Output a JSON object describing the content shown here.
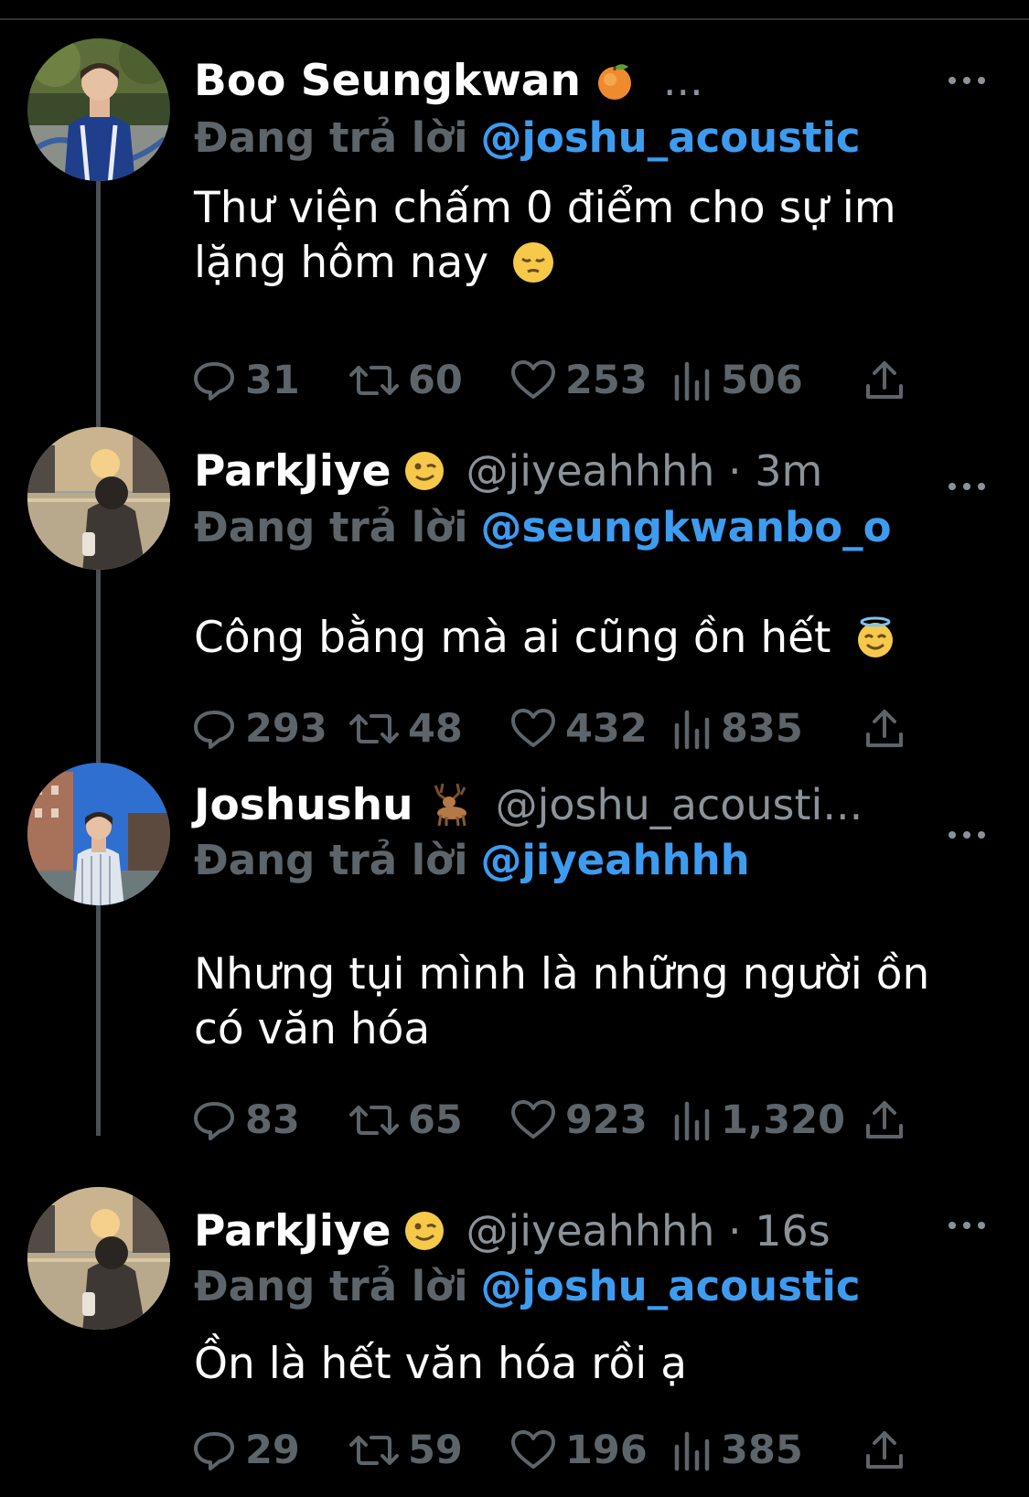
{
  "reply_prefix": "Đang trả lời",
  "tweets": [
    {
      "name": "Boo Seungkwan",
      "handle": "...",
      "badge_icon": "peach-icon",
      "mention": "@joshu_acoustic",
      "text": "Thư viện chấm 0 điểm cho sự im lặng hôm nay",
      "text_emoji": "pensive-face-icon",
      "replies": "31",
      "retweets": "60",
      "likes": "253",
      "views": "506"
    },
    {
      "name": "ParkJiye",
      "handle": "@jiyeahhhh · 3m",
      "badge_icon": "winking-face-icon",
      "mention": "@seungkwanbo_o",
      "text": "Công bằng mà ai cũng ồn hết",
      "text_emoji": "smiling-face-with-halo-icon",
      "replies": "293",
      "retweets": "48",
      "likes": "432",
      "views": "835"
    },
    {
      "name": "Joshushu",
      "handle": "@joshu_acousti...",
      "badge_icon": "deer-icon",
      "mention": "@jiyeahhhh",
      "text": "Nhưng tụi mình là những người ồn có văn hóa",
      "text_emoji": "",
      "replies": "83",
      "retweets": "65",
      "likes": "923",
      "views": "1,320"
    },
    {
      "name": "ParkJiye",
      "handle": "@jiyeahhhh · 16s",
      "badge_icon": "winking-face-icon",
      "mention": "@joshu_acoustic",
      "text": "Ồn là hết văn hóa rồi ạ",
      "text_emoji": "",
      "replies": "29",
      "retweets": "59",
      "likes": "196",
      "views": "385"
    }
  ],
  "colors": {
    "background": "#000000",
    "name": "#ffffff",
    "muted": "#5d656b",
    "mention": "#3e9cf0",
    "thread_line": "#4a4f53"
  }
}
